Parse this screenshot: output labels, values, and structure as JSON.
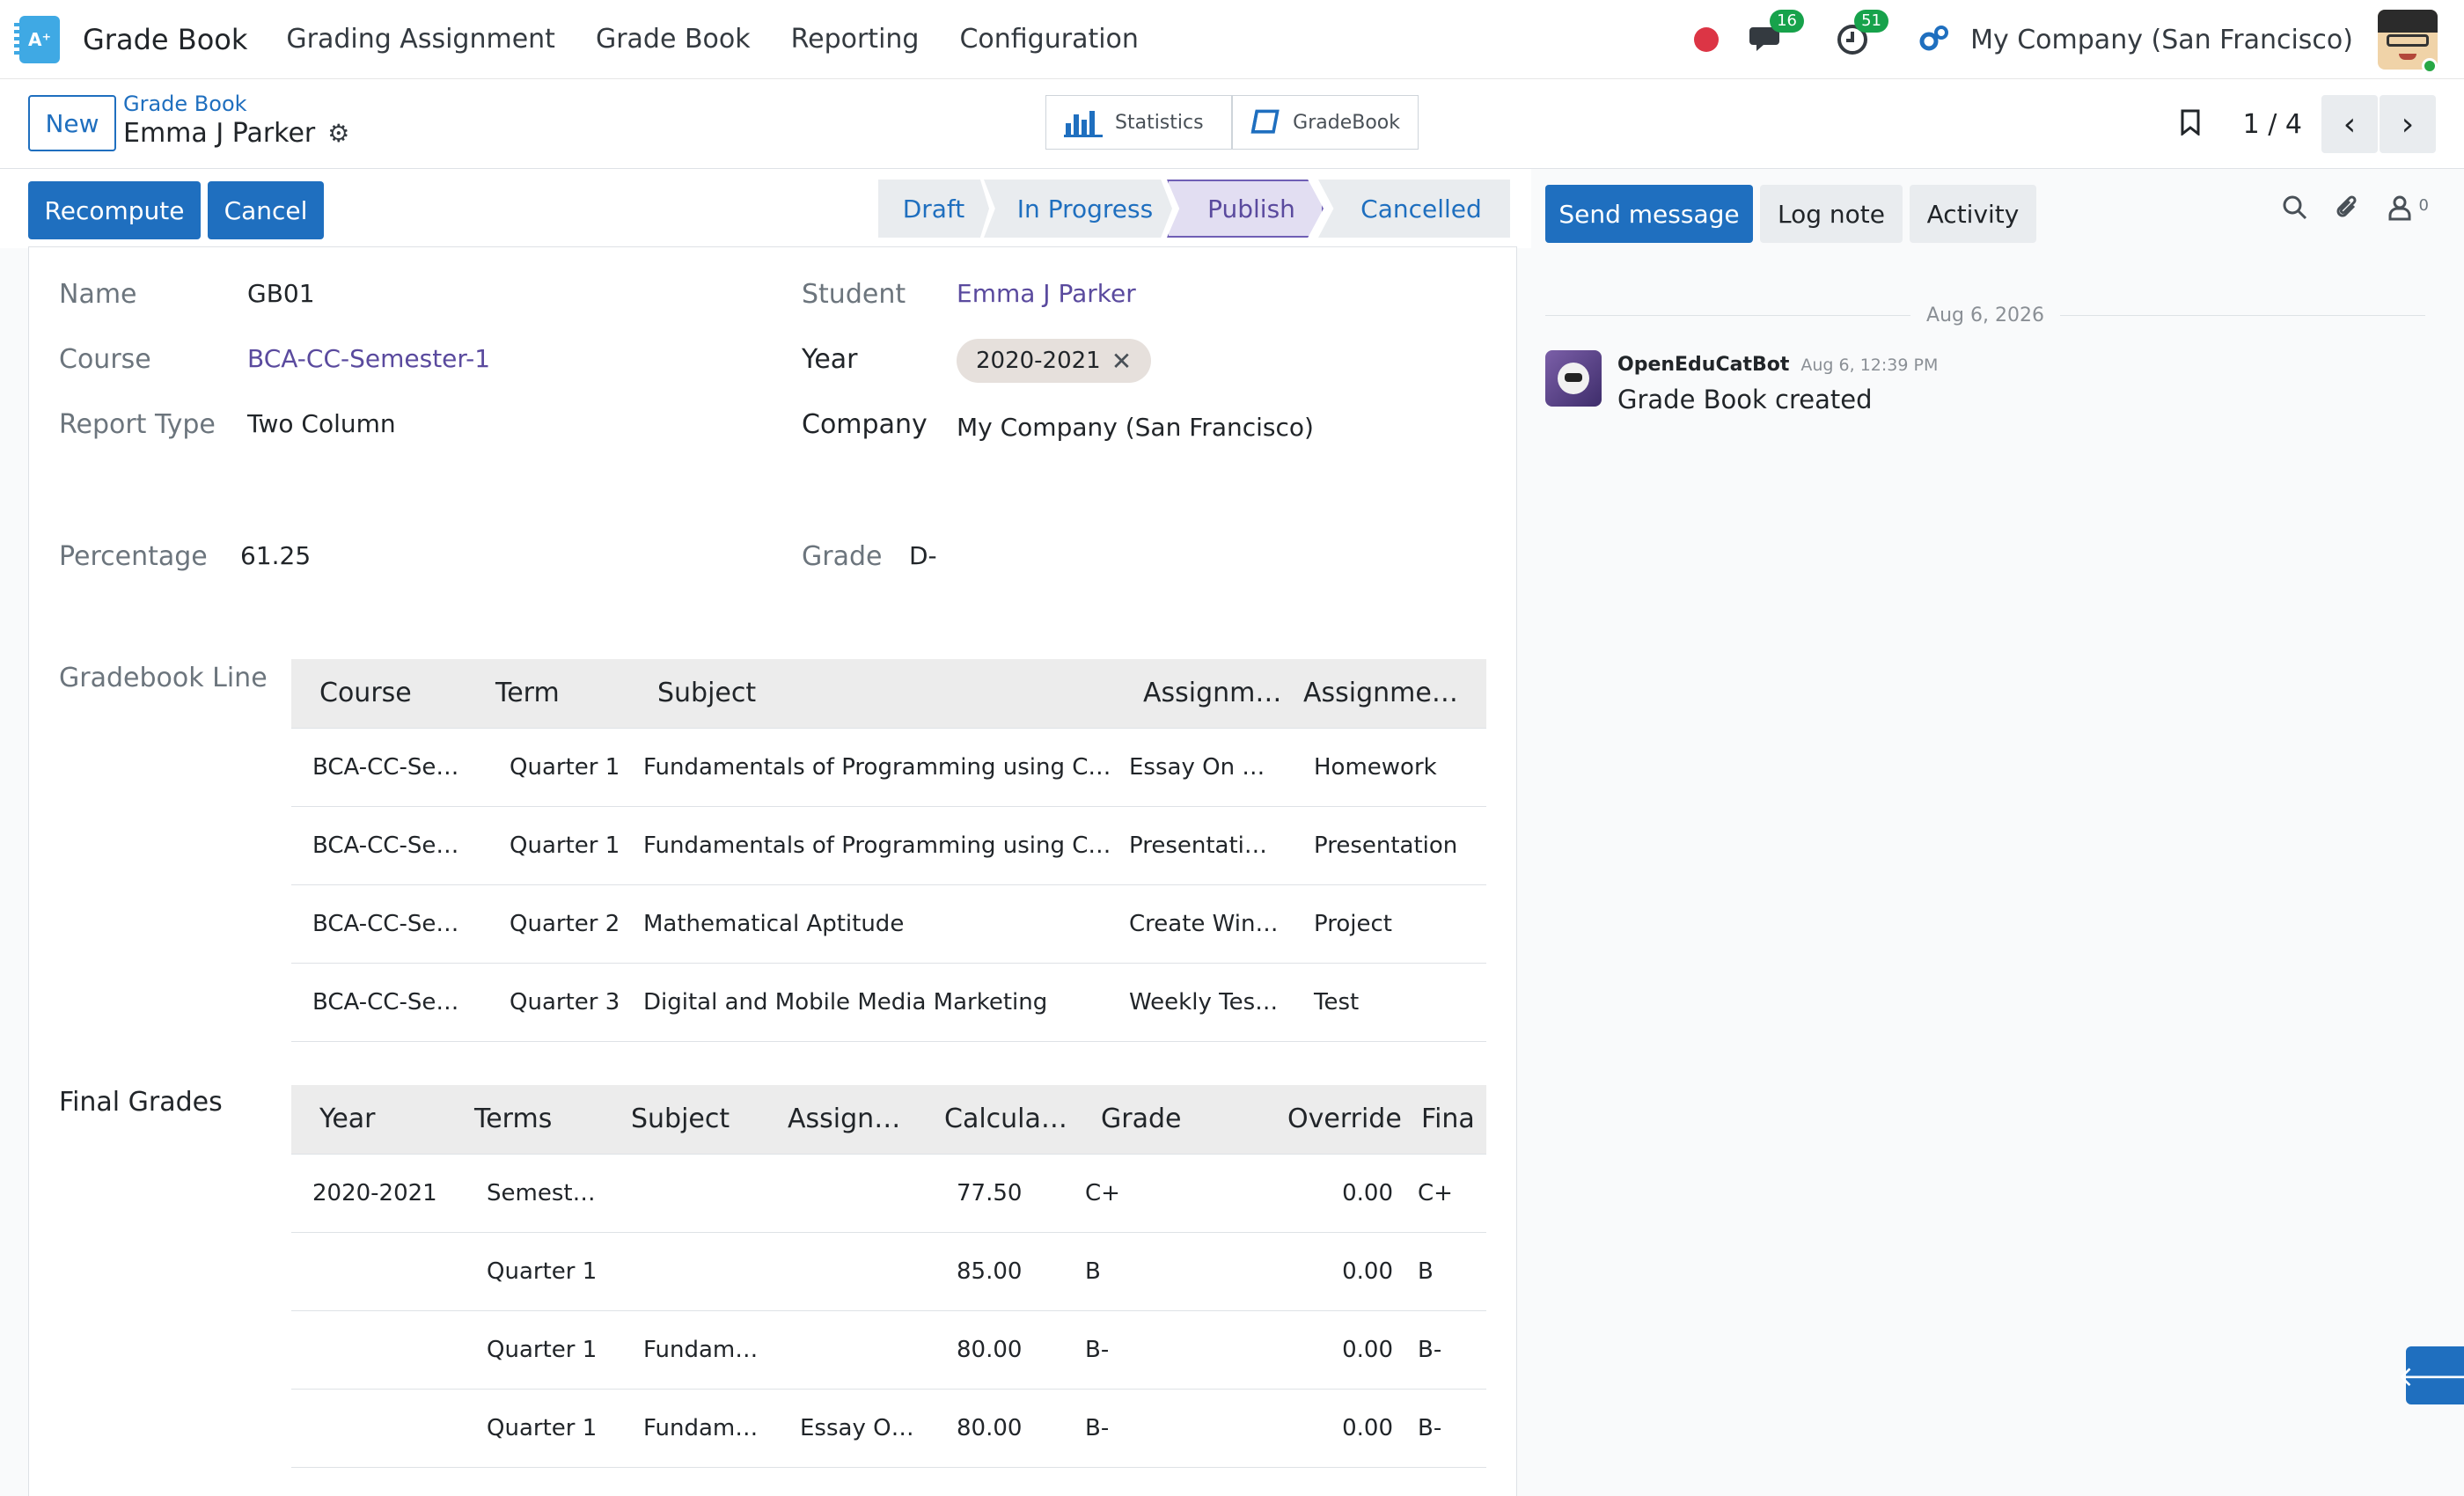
{
  "nav": {
    "app_title": "Grade Book",
    "menu": [
      "Grading Assignment",
      "Grade Book",
      "Reporting",
      "Configuration"
    ],
    "messages_badge": "16",
    "activities_badge": "51",
    "company": "My Company (San Francisco)"
  },
  "control": {
    "new_label": "New",
    "breadcrumb": "Grade Book",
    "record_name": "Emma J Parker",
    "smart_buttons": {
      "statistics": "Statistics",
      "gradebook": "GradeBook"
    },
    "pager": "1 / 4"
  },
  "status": {
    "recompute": "Recompute",
    "cancel": "Cancel",
    "stages": [
      "Draft",
      "In Progress",
      "Publish",
      "Cancelled"
    ],
    "active_stage": "Publish"
  },
  "form": {
    "name_label": "Name",
    "name_value": "GB01",
    "course_label": "Course",
    "course_value": "BCA-CC-Semester-1",
    "report_type_label": "Report Type",
    "report_type_value": "Two Column",
    "student_label": "Student",
    "student_value": "Emma J Parker",
    "year_label": "Year",
    "year_value": "2020-2021",
    "company_label": "Company",
    "company_value": "My Company (San Francisco)",
    "percentage_label": "Percentage",
    "percentage_value": "61.25",
    "grade_label": "Grade",
    "grade_value": "D-"
  },
  "gradebook_line": {
    "label": "Gradebook Line",
    "headers": [
      "Course",
      "Term",
      "Subject",
      "Assignment",
      "Assignme…"
    ],
    "rows": [
      [
        "BCA-CC-Se…",
        "Quarter 1",
        "Fundamentals of Programming using C …",
        "Essay On …",
        "Homework"
      ],
      [
        "BCA-CC-Se…",
        "Quarter 1",
        "Fundamentals of Programming using C …",
        "Presentati…",
        "Presentation"
      ],
      [
        "BCA-CC-Se…",
        "Quarter 2",
        "Mathematical Aptitude",
        "Create Win…",
        "Project"
      ],
      [
        "BCA-CC-Se…",
        "Quarter 3",
        "Digital and Mobile Media Marketing",
        "Weekly Tes…",
        "Test"
      ]
    ]
  },
  "final_grades": {
    "label": "Final Grades",
    "headers": [
      "Year",
      "Terms",
      "Subject",
      "Assignme…",
      "Calculated",
      "Grade",
      "Override",
      "Fina"
    ],
    "rows": [
      [
        "2020-2021",
        "Semeste…",
        "",
        "",
        "77.50",
        "C+",
        "0.00",
        "C+"
      ],
      [
        "",
        "Quarter 1",
        "",
        "",
        "85.00",
        "B",
        "0.00",
        "B"
      ],
      [
        "",
        "Quarter 1",
        "Fundam…",
        "",
        "80.00",
        "B-",
        "0.00",
        "B-"
      ],
      [
        "",
        "Quarter 1",
        "Fundam…",
        "Essay On…",
        "80.00",
        "B-",
        "0.00",
        "B-"
      ]
    ]
  },
  "chatter": {
    "send_message": "Send message",
    "log_note": "Log note",
    "activity": "Activity",
    "followers": "0",
    "date_separator": "Aug 6, 2026",
    "message": {
      "author": "OpenEduCatBot",
      "time": "Aug 6, 12:39 PM",
      "text": "Grade Book created"
    }
  }
}
